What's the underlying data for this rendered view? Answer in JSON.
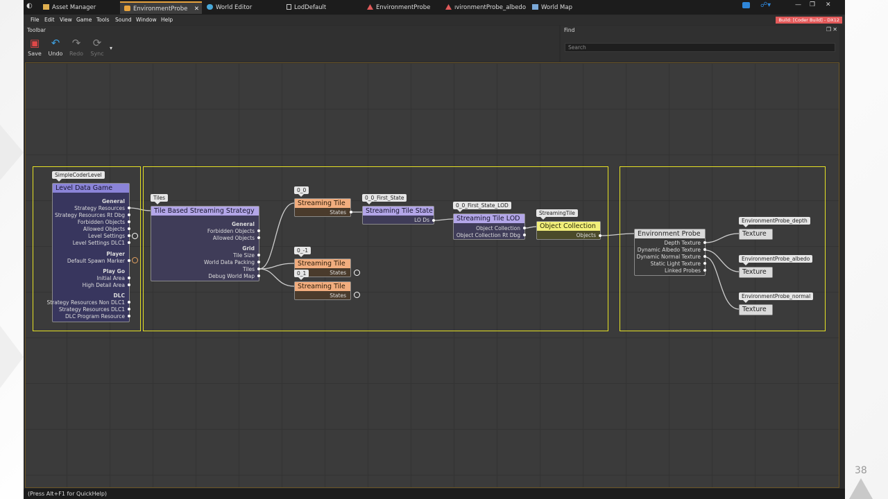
{
  "tabs": [
    {
      "label": "Asset Manager"
    },
    {
      "label": "EnvironmentProbe",
      "active": true
    },
    {
      "label": "World Editor"
    },
    {
      "label": "LodDefault"
    },
    {
      "label": "EnvironmentProbe"
    },
    {
      "label": "ıvironmentProbe_albedo"
    },
    {
      "label": "World Map"
    }
  ],
  "menu": [
    "File",
    "Edit",
    "View",
    "Game",
    "Tools",
    "Sound",
    "Window",
    "Help"
  ],
  "build_label": "Build: [Coder Build] - DX12",
  "toolbar": {
    "title": "Toolbar",
    "save": "Save",
    "undo": "Undo",
    "redo": "Redo",
    "sync": "Sync"
  },
  "find": {
    "title": "Find",
    "placeholder": "Search"
  },
  "graph": {
    "tags": {
      "simple_coder_level": "SimpleCoderLevel",
      "tiles": "Tiles",
      "t00": "0_0",
      "t0m1": "0_-1",
      "t01": "0_1",
      "first_state": "0_0_First_State",
      "first_state_lod": "0_0_First_State_LOD",
      "streaming_tile": "StreamingTile",
      "probe_depth": "EnvironmentProbe_depth",
      "probe_albedo": "EnvironmentProbe_albedo",
      "probe_normal": "EnvironmentProbe_normal"
    },
    "level_data_game": {
      "title": "Level Data Game",
      "general": "General",
      "rows1": [
        "Strategy Resources",
        "Strategy Resources Rt Dbg",
        "Forbidden Objects",
        "Allowed Objects",
        "Level Settings",
        "Level Settings DLC1"
      ],
      "player": "Player",
      "rows2": [
        "Default Spawn Marker"
      ],
      "play_go": "Play Go",
      "rows3": [
        "Initial Area",
        "High Detail Area"
      ],
      "dlc": "DLC",
      "rows4": [
        "Strategy Resources Non DLC1",
        "Strategy Resources DLC1",
        "DLC Program Resource"
      ]
    },
    "tile_strategy": {
      "title": "Tile Based Streaming Strategy",
      "general": "General",
      "rows1": [
        "Forbidden Objects",
        "Allowed Objects"
      ],
      "grid": "Grid",
      "rows2": [
        "Tile Size",
        "World Data Packing",
        "Tiles",
        "Debug World Map"
      ]
    },
    "streaming_tile_label": "Streaming Tile",
    "states_label": "States",
    "tile_state": {
      "title": "Streaming Tile State",
      "row": "LO Ds"
    },
    "tile_lod": {
      "title": "Streaming Tile LOD",
      "rows": [
        "Object Collection",
        "Object Collection Rt Dbg"
      ]
    },
    "object_collection": {
      "title": "Object Collection",
      "row": "Objects"
    },
    "env_probe": {
      "title": "Environment Probe",
      "rows": [
        "Depth Texture",
        "Dynamic Albedo Texture",
        "Dynamic Normal Texture",
        "Static Light Texture",
        "Linked Probes"
      ]
    },
    "texture_label": "Texture"
  },
  "status": "(Press Alt+F1 for QuickHelp)",
  "page_number": "38",
  "colors": {
    "accent": "#e8a33c",
    "frame": "#e7e325",
    "level_head": "#8b84d8",
    "level_body": "#38365e",
    "tile_head": "#f2ad7e",
    "tile_body": "#4a3b2c",
    "collection_head": "#f2ef7a",
    "probe_head": "#dadada"
  }
}
